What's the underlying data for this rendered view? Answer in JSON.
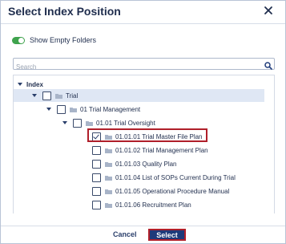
{
  "dialog": {
    "title": "Select Index Position",
    "close_icon": "close-icon"
  },
  "toggle": {
    "label": "Show Empty Folders",
    "on": true,
    "color": "#3fa34d"
  },
  "search": {
    "placeholder": "Search",
    "value": "",
    "icon": "search-icon"
  },
  "tree": {
    "root_label": "Index",
    "nodes": [
      {
        "label": "Trial",
        "checked": false,
        "expanded": true,
        "selected": true
      },
      {
        "label": "01 Trial Management",
        "checked": false,
        "expanded": true
      },
      {
        "label": "01.01 Trial Oversight",
        "checked": false,
        "expanded": true
      },
      {
        "label": "01.01.01 Trial Master File Plan",
        "checked": true
      },
      {
        "label": "01.01.02 Trial Management Plan",
        "checked": false
      },
      {
        "label": "01.01.03 Quality Plan",
        "checked": false
      },
      {
        "label": "01.01.04 List of SOPs Current During Trial",
        "checked": false
      },
      {
        "label": "01.01.05 Operational Procedure Manual",
        "checked": false
      },
      {
        "label": "01.01.06 Recruitment Plan",
        "checked": false
      }
    ]
  },
  "footer": {
    "cancel_label": "Cancel",
    "select_label": "Select"
  },
  "colors": {
    "accent": "#1e3a7a",
    "highlight": "#b01f2a",
    "selected_row": "#dfe7f4",
    "folder": "#a8b4c8"
  }
}
